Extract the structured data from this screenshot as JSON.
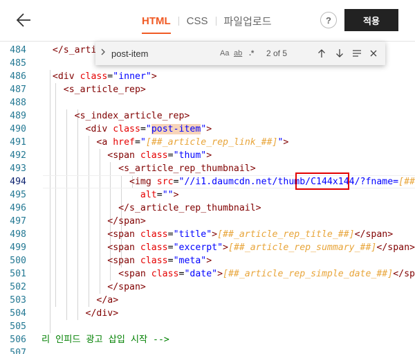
{
  "header": {
    "back_label": "←",
    "tabs": [
      {
        "label": "HTML",
        "active": true
      },
      {
        "label": "CSS",
        "active": false
      },
      {
        "label": "파일업로드",
        "active": false
      }
    ],
    "help_label": "?",
    "apply_label": "적용"
  },
  "find": {
    "toggle_label": ">",
    "query": "post-item",
    "match_case_label": "Aa",
    "whole_word_label": "ab",
    "regex_label": ".*",
    "match_count": "2 of 5",
    "prev_icon": "arrow-up-icon",
    "next_icon": "arrow-down-icon",
    "selection_icon": "find-in-selection-icon",
    "close_icon": "close-icon"
  },
  "editor": {
    "lines": [
      {
        "n": "484",
        "tokens": [
          [
            "x",
            "  "
          ],
          [
            "t",
            "</s_arti"
          ]
        ]
      },
      {
        "n": "485",
        "tokens": []
      },
      {
        "n": "486",
        "tokens": [
          [
            "x",
            "  "
          ],
          [
            "t",
            "<div "
          ],
          [
            "a",
            "class"
          ],
          [
            "x",
            "="
          ],
          [
            "v",
            "\"inner\""
          ],
          [
            "t",
            ">"
          ]
        ]
      },
      {
        "n": "487",
        "tokens": [
          [
            "x",
            "    "
          ],
          [
            "t",
            "<s_article_rep>"
          ]
        ]
      },
      {
        "n": "488",
        "tokens": []
      },
      {
        "n": "489",
        "tokens": [
          [
            "x",
            "      "
          ],
          [
            "t",
            "<s_index_article_rep>"
          ]
        ]
      },
      {
        "n": "490",
        "tokens": [
          [
            "x",
            "        "
          ],
          [
            "t",
            "<div "
          ],
          [
            "a",
            "class"
          ],
          [
            "x",
            "="
          ],
          [
            "v",
            "\""
          ],
          [
            "vh",
            "post-item"
          ],
          [
            "v",
            "\""
          ],
          [
            "t",
            ">"
          ]
        ]
      },
      {
        "n": "491",
        "tokens": [
          [
            "x",
            "          "
          ],
          [
            "t",
            "<a "
          ],
          [
            "a",
            "href"
          ],
          [
            "x",
            "="
          ],
          [
            "v",
            "\""
          ],
          [
            "tv",
            "[##_article_rep_link_##]"
          ],
          [
            "v",
            "\""
          ],
          [
            "t",
            ">"
          ]
        ]
      },
      {
        "n": "492",
        "tokens": [
          [
            "x",
            "            "
          ],
          [
            "t",
            "<span "
          ],
          [
            "a",
            "class"
          ],
          [
            "x",
            "="
          ],
          [
            "v",
            "\"thum\""
          ],
          [
            "t",
            ">"
          ]
        ]
      },
      {
        "n": "493",
        "tokens": [
          [
            "x",
            "              "
          ],
          [
            "t",
            "<s_article_rep_thumbnail>"
          ]
        ]
      },
      {
        "n": "494",
        "cur": true,
        "tokens": [
          [
            "x",
            "                "
          ],
          [
            "t",
            "<img "
          ],
          [
            "a",
            "src"
          ],
          [
            "x",
            "="
          ],
          [
            "v",
            "\"//i1.daumcdn.net/thumb/C144x144/?fname="
          ],
          [
            "tv",
            "[##"
          ]
        ]
      },
      {
        "n": "495",
        "tokens": [
          [
            "x",
            "                  "
          ],
          [
            "a",
            "alt"
          ],
          [
            "x",
            "="
          ],
          [
            "v",
            "\"\""
          ],
          [
            "t",
            ">"
          ]
        ]
      },
      {
        "n": "496",
        "tokens": [
          [
            "x",
            "              "
          ],
          [
            "t",
            "</s_article_rep_thumbnail>"
          ]
        ]
      },
      {
        "n": "497",
        "tokens": [
          [
            "x",
            "            "
          ],
          [
            "t",
            "</span>"
          ]
        ]
      },
      {
        "n": "498",
        "tokens": [
          [
            "x",
            "            "
          ],
          [
            "t",
            "<span "
          ],
          [
            "a",
            "class"
          ],
          [
            "x",
            "="
          ],
          [
            "v",
            "\"title\""
          ],
          [
            "t",
            ">"
          ],
          [
            "tv",
            "[##_article_rep_title_##]"
          ],
          [
            "t",
            "</span>"
          ]
        ]
      },
      {
        "n": "499",
        "tokens": [
          [
            "x",
            "            "
          ],
          [
            "t",
            "<span "
          ],
          [
            "a",
            "class"
          ],
          [
            "x",
            "="
          ],
          [
            "v",
            "\"excerpt\""
          ],
          [
            "t",
            ">"
          ],
          [
            "tv",
            "[##_article_rep_summary_##]"
          ],
          [
            "t",
            "</span>"
          ]
        ]
      },
      {
        "n": "500",
        "tokens": [
          [
            "x",
            "            "
          ],
          [
            "t",
            "<span "
          ],
          [
            "a",
            "class"
          ],
          [
            "x",
            "="
          ],
          [
            "v",
            "\"meta\""
          ],
          [
            "t",
            ">"
          ]
        ]
      },
      {
        "n": "501",
        "tokens": [
          [
            "x",
            "              "
          ],
          [
            "t",
            "<span "
          ],
          [
            "a",
            "class"
          ],
          [
            "x",
            "="
          ],
          [
            "v",
            "\"date\""
          ],
          [
            "t",
            ">"
          ],
          [
            "tv",
            "[##_article_rep_simple_date_##]"
          ],
          [
            "t",
            "</spa"
          ]
        ]
      },
      {
        "n": "502",
        "tokens": [
          [
            "x",
            "            "
          ],
          [
            "t",
            "</span>"
          ]
        ]
      },
      {
        "n": "503",
        "tokens": [
          [
            "x",
            "          "
          ],
          [
            "t",
            "</a>"
          ]
        ]
      },
      {
        "n": "504",
        "tokens": [
          [
            "x",
            "        "
          ],
          [
            "t",
            "</div>"
          ]
        ]
      },
      {
        "n": "505",
        "tokens": []
      },
      {
        "n": "506",
        "tokens": [
          [
            "cm",
            "리 인피드 광고 삽입 시작 -->"
          ]
        ]
      },
      {
        "n": "507",
        "tokens": []
      }
    ]
  }
}
